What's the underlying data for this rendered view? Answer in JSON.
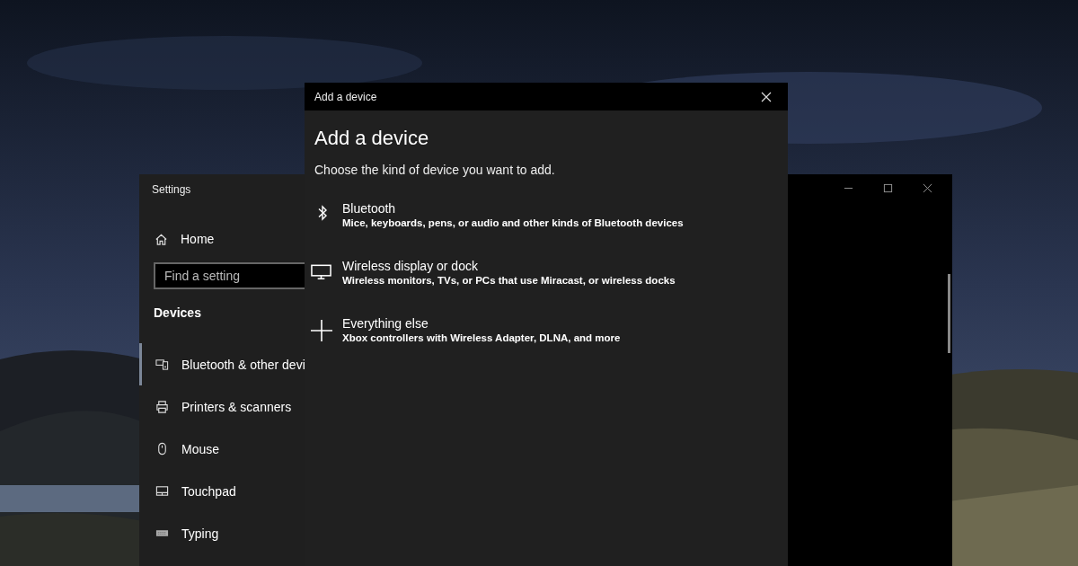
{
  "settings_window": {
    "title": "Settings",
    "home": "Home",
    "search": {
      "placeholder": "Find a setting"
    },
    "section": "Devices",
    "items": [
      {
        "label": "Bluetooth & other devi",
        "selected": true
      },
      {
        "label": "Printers & scanners",
        "selected": false
      },
      {
        "label": "Mouse",
        "selected": false
      },
      {
        "label": "Touchpad",
        "selected": false
      },
      {
        "label": "Typing",
        "selected": false
      }
    ]
  },
  "dialog": {
    "title": "Add a device",
    "heading": "Add a device",
    "subtitle": "Choose the kind of device you want to add.",
    "options": [
      {
        "title": "Bluetooth",
        "description": "Mice, keyboards, pens, or audio and other kinds of Bluetooth devices"
      },
      {
        "title": "Wireless display or dock",
        "description": "Wireless monitors, TVs, or PCs that use Miracast, or wireless docks"
      },
      {
        "title": "Everything else",
        "description": "Xbox controllers with Wireless Adapter, DLNA, and more"
      }
    ]
  }
}
